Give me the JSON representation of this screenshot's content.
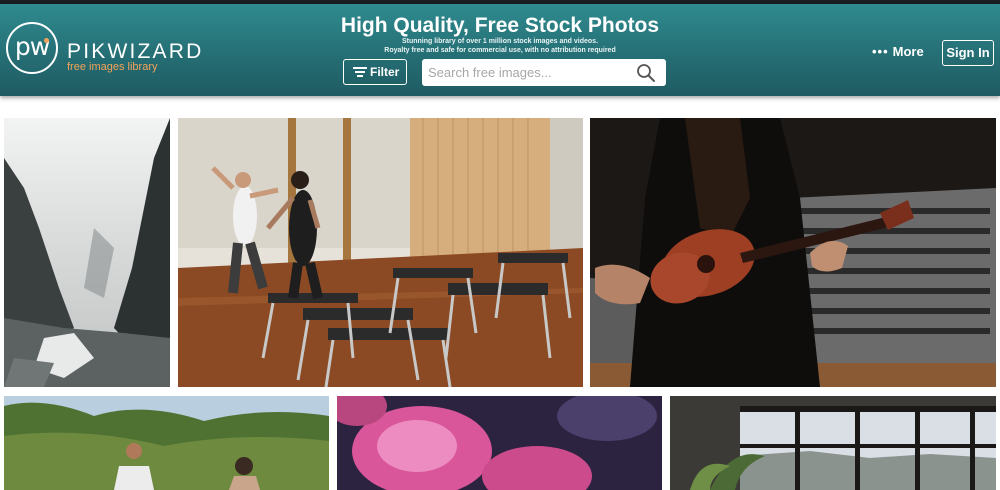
{
  "header": {
    "brand_name": "PIKWIZARD",
    "brand_tagline": "free images library",
    "logo_text": "pw",
    "headline": "High Quality, Free Stock Photos",
    "subline_1": "Stunning library of over 1 million stock images and videos.",
    "subline_2": "Royalty free and safe for commercial use, with no attribution required",
    "filter_label": "Filter",
    "search_placeholder": "Search free images...",
    "more_label": "More",
    "more_icon": "•••",
    "signin_label": "Sign In"
  },
  "colors": {
    "header_teal": "#2a7d82",
    "tagline_orange": "#f4a259"
  },
  "icons": {
    "filter": "filter-lines-icon",
    "search": "magnifier-icon",
    "more": "horizontal-dots-icon"
  },
  "photos": [
    {
      "subject": "misty mountain gorge"
    },
    {
      "subject": "pilates studio trainer"
    },
    {
      "subject": "ukulele and mixing console"
    },
    {
      "subject": "yoga people outdoors"
    },
    {
      "subject": "pink roses"
    },
    {
      "subject": "office window plants"
    }
  ]
}
